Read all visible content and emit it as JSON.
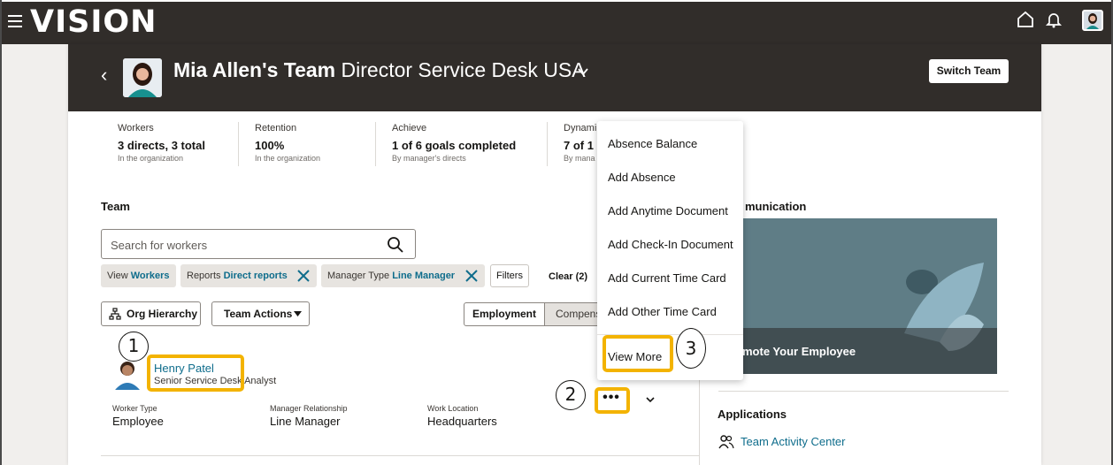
{
  "app": {
    "brand": "VISION"
  },
  "header": {
    "team_owner": "Mia Allen's Team",
    "position": "Director Service Desk USA",
    "switch_team_label": "Switch Team"
  },
  "metrics": [
    {
      "label": "Workers",
      "value": "3 directs, 3 total",
      "sub": "In the organization"
    },
    {
      "label": "Retention",
      "value": "100%",
      "sub": "In the organization"
    },
    {
      "label": "Achieve",
      "value": "1 of 6 goals completed",
      "sub": "By manager's directs"
    },
    {
      "label": "Dynami",
      "value": "7 of 1",
      "sub": "By mana"
    }
  ],
  "team": {
    "heading": "Team",
    "search_placeholder": "Search for workers",
    "chips": [
      {
        "label": "View",
        "value": "Workers"
      },
      {
        "label": "Reports",
        "value": "Direct reports"
      },
      {
        "label": "Manager Type",
        "value": "Line Manager"
      }
    ],
    "filters_label": "Filters",
    "clear_label": "Clear (2)",
    "org_hierarchy_label": "Org Hierarchy",
    "team_actions_label": "Team Actions",
    "seg_employment": "Employment",
    "seg_compensation": "Compens"
  },
  "person": {
    "name": "Henry Patel",
    "role": "Senior Service Desk Analyst",
    "worker_type_label": "Worker Type",
    "worker_type": "Employee",
    "manager_rel_label": "Manager Relationship",
    "manager_rel": "Line Manager",
    "location_label": "Work Location",
    "location": "Headquarters",
    "more_label": "•••"
  },
  "communication": {
    "heading": "munication",
    "promo_title": "romote Your Employee"
  },
  "applications": {
    "heading": "Applications",
    "links": [
      "Team Activity Center"
    ]
  },
  "menu": {
    "items": [
      "Absence Balance",
      "Add Absence",
      "Add Anytime Document",
      "Add Check-In Document",
      "Add Current Time Card",
      "Add Other Time Card"
    ],
    "view_more": "View More"
  },
  "callouts": [
    "1",
    "2",
    "3"
  ],
  "colors": {
    "highlight": "#f3b300",
    "link": "#0f6d8c",
    "header": "#312d2a"
  },
  "icons": [
    "hamburger-icon",
    "home-icon",
    "bell-icon",
    "user-avatar",
    "back-chevron-icon",
    "chevron-down-icon",
    "search-icon",
    "close-icon",
    "org-hierarchy-icon",
    "caret-down-icon",
    "team-activity-icon"
  ]
}
